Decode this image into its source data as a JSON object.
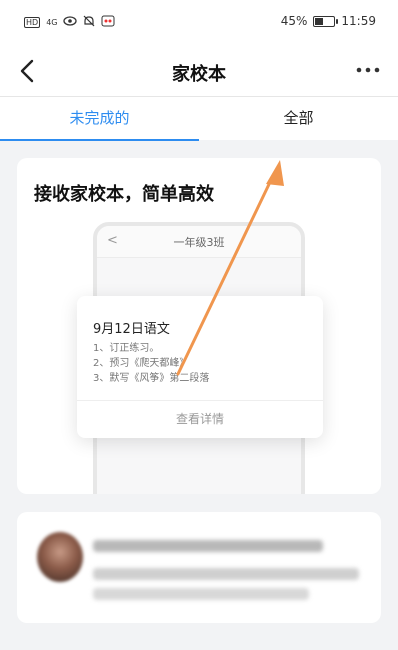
{
  "status_bar": {
    "left_icons": [
      "HD",
      "4G",
      "eye-icon",
      "mute-icon",
      "notification-icon"
    ],
    "battery": "45%",
    "time": "11:59"
  },
  "nav": {
    "title": "家校本"
  },
  "tabs": [
    {
      "label": "未完成的"
    },
    {
      "label": "全部"
    }
  ],
  "card1": {
    "title": "接收家校本，简单高效",
    "phone": {
      "back": "<",
      "title": "一年级3班"
    },
    "homework": {
      "title": "9月12日语文",
      "items": [
        "1、订正练习。",
        "2、预习《爬天都峰》",
        "3、默写《风筝》第二段落"
      ],
      "detail": "查看详情"
    }
  },
  "colors": {
    "accent": "#2d8cf0",
    "annotation_arrow": "#f0964e"
  }
}
